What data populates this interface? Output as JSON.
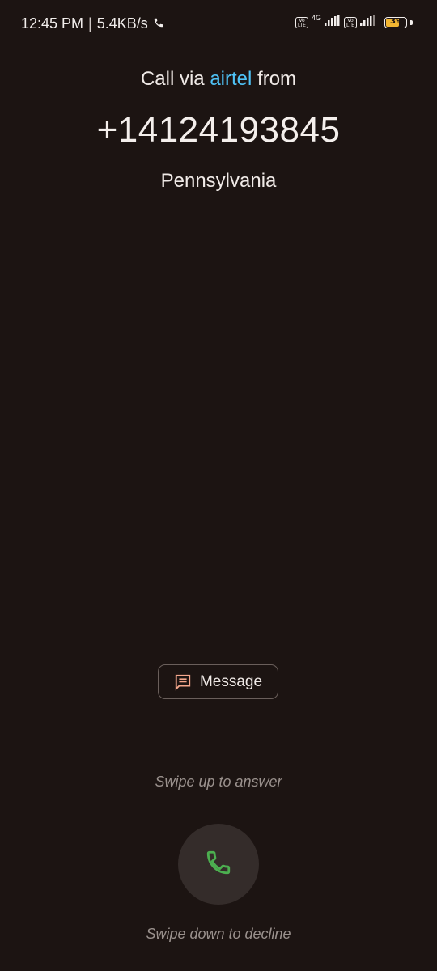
{
  "status_bar": {
    "time": "12:45 PM",
    "separator": "|",
    "net_speed": "5.4KB/s",
    "call_icon": "phone-icon",
    "sim1_badge": "Vo LTE",
    "network_type": "4G",
    "sim2_badge": "Vo LTE",
    "battery_level": "39",
    "battery_color": "#f2b632"
  },
  "caller": {
    "prefix": "Call via",
    "carrier": "airtel",
    "suffix": "from",
    "number": "+14124193845",
    "location": "Pennsylvania"
  },
  "actions": {
    "message_label": "Message",
    "message_icon": "message-icon",
    "answer_icon": "phone-answer-icon"
  },
  "hints": {
    "swipe_up": "Swipe up to answer",
    "swipe_down": "Swipe down to decline"
  },
  "colors": {
    "background": "#1c1412",
    "carrier_accent": "#4fc3f7",
    "answer_green": "#4caf50",
    "message_icon_color": "#f4a78c"
  }
}
